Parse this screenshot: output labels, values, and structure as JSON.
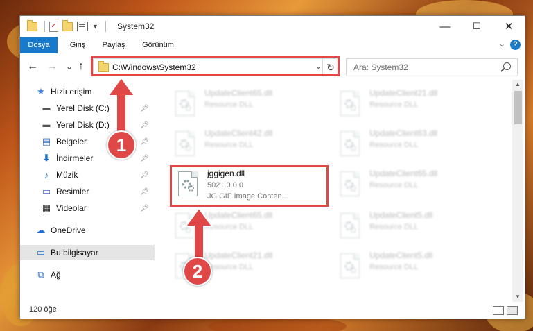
{
  "window": {
    "title": "System32",
    "quick_access_icons": [
      "folder-icon",
      "checkmark-icon",
      "folder-icon",
      "properties-icon"
    ],
    "controls": {
      "minimize": "—",
      "maximize": "☐",
      "close": "✕"
    }
  },
  "ribbon": {
    "tabs": [
      "Dosya",
      "Giriş",
      "Paylaş",
      "Görünüm"
    ],
    "active_tab": "Dosya",
    "accent": "#1979ca",
    "help": "?"
  },
  "navigation": {
    "back": "←",
    "forward": "→",
    "recent": "⌄",
    "up": "↑",
    "address": "C:\\Windows\\System32",
    "refresh": "↻",
    "search_placeholder": "Ara: System32"
  },
  "sidebar": {
    "items": [
      {
        "label": "Hızlı erişim",
        "icon": "star-icon",
        "pinned": false
      },
      {
        "label": "Yerel Disk (C:)",
        "icon": "drive-icon",
        "pinned": true
      },
      {
        "label": "Yerel Disk (D:)",
        "icon": "drive-icon",
        "pinned": true
      },
      {
        "label": "Belgeler",
        "icon": "documents-icon",
        "pinned": true
      },
      {
        "label": "İndirmeler",
        "icon": "download-icon",
        "pinned": true
      },
      {
        "label": "Müzik",
        "icon": "music-icon",
        "pinned": true
      },
      {
        "label": "Resimler",
        "icon": "pictures-icon",
        "pinned": true
      },
      {
        "label": "Videolar",
        "icon": "videos-icon",
        "pinned": true
      },
      {
        "label": "OneDrive",
        "icon": "cloud-icon",
        "pinned": false
      },
      {
        "label": "Bu bilgisayar",
        "icon": "computer-icon",
        "pinned": false,
        "selected": true
      },
      {
        "label": "Ağ",
        "icon": "network-icon",
        "pinned": false
      }
    ]
  },
  "files": [
    {
      "name": "UpdateClient65.dll",
      "type": "Resource DLL",
      "blurred": true
    },
    {
      "name": "UpdateClient21.dll",
      "type": "Resource DLL",
      "blurred": true
    },
    {
      "name": "UpdateClient42.dll",
      "type": "Resource DLL",
      "blurred": true
    },
    {
      "name": "UpdateClient63.dll",
      "type": "Resource DLL",
      "blurred": true
    },
    {
      "name": "jggigen.dll",
      "version": "5021.0.0.0",
      "description": "JG GIF Image Conten...",
      "blurred": false,
      "highlighted": true
    },
    {
      "name": "UpdateClient65.dll",
      "type": "Resource DLL",
      "blurred": true
    },
    {
      "name": "UpdateClient65.dll",
      "type": "Resource DLL",
      "blurred": true
    },
    {
      "name": "UpdateClient5.dll",
      "type": "Resource DLL",
      "blurred": true
    },
    {
      "name": "UpdateClient21.dll",
      "type": "Resource DLL",
      "blurred": true
    },
    {
      "name": "UpdateClient5.dll",
      "type": "Resource DLL",
      "blurred": true
    }
  ],
  "status": {
    "item_count": "120 öğe"
  },
  "annotations": {
    "color": "#e04848",
    "steps": [
      "1",
      "2"
    ]
  }
}
